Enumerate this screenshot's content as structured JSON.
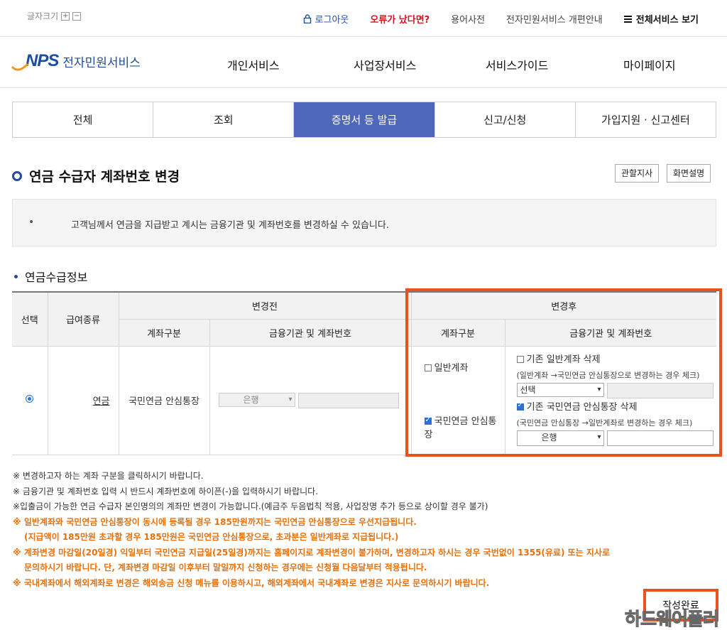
{
  "util": {
    "font_size_label": "글자크기",
    "font_plus": "+",
    "font_minus": "−",
    "logout": "로그아웃",
    "error": "오류가 났다면?",
    "glossary": "용어사전",
    "renewal": "전자민원서비스 개편안내",
    "all_services": "전체서비스 보기"
  },
  "brand": {
    "logo": "NPS",
    "service": "전자민원서비스"
  },
  "gnb": [
    "개인서비스",
    "사업장서비스",
    "서비스가이드",
    "마이페이지"
  ],
  "tabs": [
    {
      "label": "전체"
    },
    {
      "label": "조회"
    },
    {
      "label": "증명서 등 발급",
      "active": true
    },
    {
      "label": "신고/신청"
    },
    {
      "label": "가입지원 · 신고센터"
    }
  ],
  "page": {
    "title": "연금 수급자 계좌번호 변경",
    "btn_branch": "관할지사",
    "btn_help": "화면설명"
  },
  "notice": {
    "bullet": "•",
    "text": "고객님께서 연금을 지급받고 계시는 금융기관 및 계좌번호를 변경하실 수 있습니다."
  },
  "section": {
    "title": "연금수급정보"
  },
  "table": {
    "h_select": "선택",
    "h_type": "급여종류",
    "h_before": "변경전",
    "h_after": "변경후",
    "h_acct_type": "계좌구분",
    "h_bank_acct": "금융기관 및 계좌번호",
    "row": {
      "benefit": "연금",
      "before_acct_type": "국민연금 안심통장",
      "before_bank": "은행",
      "opt_general": "일반계좌",
      "opt_safe": "국민연금 안심통장",
      "del_general": "기존 일반계좌 삭제",
      "hint_general": "(일반계좌 →국민연금 안심통장으로 변경하는 경우 체크)",
      "general_select": "선택",
      "del_safe": "기존 국민연금 안심통장 삭제",
      "hint_safe": "(국민연금 안심통장 →일반계좌로 변경하는 경우 체크)",
      "safe_bank": "은행"
    }
  },
  "notes": [
    "※ 변경하고자 하는 계좌 구분을 클릭하시기 바랍니다.",
    "※ 금융기관 및 계좌번호 입력 시 반드시 계좌번호에 하이픈(-)을 입력하시기 바랍니다.",
    "※입출금이 가능한 연금 수급자 본인명의의 계좌만 변경이 가능합니다.(예금주 두음법칙 적용, 사업장명 추가 등으로 상이할 경우 불가)",
    "※ 일반계좌와 국민연금 안심통장이 동시에 등록될 경우 185만원까지는 국민연금 안심통장으로 우선지급됩니다.",
    "(지급액이 185만원 초과할 경우 185만원은 국민연금 안심통장으로, 초과분은 일반계좌로 지급됩니다.)",
    "※ 계좌변경 마감일(20일경) 익일부터 국민연금 지급일(25일경)까지는 홈페이지로 계좌변경이 불가하며, 변경하고자 하시는 경우 국번없이 1355(유료) 또는 지사로",
    "문의하시기 바랍니다. 단, 계좌변경 마감일 이후부터 말일까지 신청하는 경우에는 신청월 다음달부터 적용됩니다.",
    "※ 국내계좌에서 해외계좌로 변경은 해외송금 신청 메뉴를 이용하시고, 해외계좌에서 국내계좌로 변경은 지사로 문의하시기 바랍니다."
  ],
  "submit": "작성완료",
  "watermark": "하드웨어플러스"
}
